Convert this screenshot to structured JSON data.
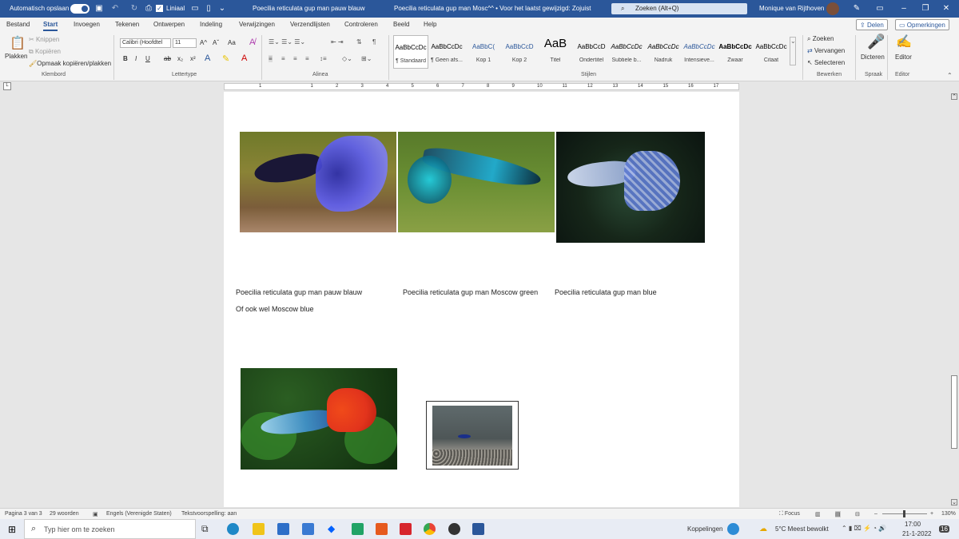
{
  "titlebar": {
    "autosave_label": "Automatisch opslaan",
    "liniaal_label": "Liniaal",
    "doc_title": "Poecilia reticulata gup man pauw blauw",
    "doc_title2": "Poecilia reticulata gup man Mosc^^ • Voor het laatst gewijzigd: Zojuist",
    "search_placeholder": "Zoeken (Alt+Q)",
    "user": "Monique van Rijthoven",
    "accent": "#2b579a"
  },
  "tabs": [
    "Bestand",
    "Start",
    "Invoegen",
    "Tekenen",
    "Ontwerpen",
    "Indeling",
    "Verwijzingen",
    "Verzendlijsten",
    "Controleren",
    "Beeld",
    "Help"
  ],
  "share_label": "Delen",
  "comments_label": "Opmerkingen",
  "clipboard": {
    "paste": "Plakken",
    "cut": "Knippen",
    "copy": "Kopiëren",
    "format_painter": "Opmaak kopiëren/plakken",
    "group": "Klembord"
  },
  "font": {
    "name": "Calibri (Hoofdtel",
    "size": "11",
    "group": "Lettertype",
    "buttons": [
      "B",
      "I",
      "U",
      "ab",
      "x₂",
      "x²"
    ],
    "grow": "A^",
    "shrink": "Aˇ",
    "case": "Aa"
  },
  "paragraph": {
    "group": "Alinea"
  },
  "styles": {
    "group": "Stijlen",
    "items": [
      {
        "sample": "AaBbCcDc",
        "name": "¶ Standaard"
      },
      {
        "sample": "AaBbCcDc",
        "name": "¶ Geen afs..."
      },
      {
        "sample": "AaBbC(",
        "name": "Kop 1"
      },
      {
        "sample": "AaBbCcD",
        "name": "Kop 2"
      },
      {
        "sample": "AaB",
        "name": "Titel"
      },
      {
        "sample": "AaBbCcD",
        "name": "Ondertitel"
      },
      {
        "sample": "AaBbCcDc",
        "name": "Subtiele b..."
      },
      {
        "sample": "AaBbCcDc",
        "name": "Nadruk"
      },
      {
        "sample": "AaBbCcDc",
        "name": "Intensieve..."
      },
      {
        "sample": "AaBbCcDc",
        "name": "Zwaar"
      },
      {
        "sample": "AaBbCcDc",
        "name": "Citaat"
      }
    ]
  },
  "editing": {
    "find": "Zoeken",
    "replace": "Vervangen",
    "select": "Selecteren",
    "group": "Bewerken"
  },
  "voice": {
    "label": "Dicteren",
    "group": "Spraak"
  },
  "editor": {
    "label": "Editor",
    "group": "Editor"
  },
  "ruler_numbers": [
    "1",
    "1",
    "2",
    "3",
    "4",
    "5",
    "6",
    "7",
    "8",
    "9",
    "10",
    "11",
    "12",
    "13",
    "14",
    "15",
    "16",
    "17"
  ],
  "document": {
    "captions": {
      "c1": "Poecilia reticulata gup man pauw blauw",
      "c2": "Poecilia reticulata gup man Moscow green",
      "c3": "Poecilia reticulata gup man blue",
      "c4": "Of ook wel Moscow blue"
    }
  },
  "status": {
    "page": "Pagina 3 van 3",
    "words": "29 woorden",
    "language": "Engels (Verenigde Staten)",
    "predict": "Tekstvoorspelling: aan",
    "focus": "Focus",
    "zoom": "130%"
  },
  "taskbar": {
    "search": "Typ hier om te zoeken",
    "koppelingen": "Koppelingen",
    "weather": "5°C Meest bewolkt",
    "time": "17:00",
    "date": "21-1-2022",
    "notif": "16"
  }
}
